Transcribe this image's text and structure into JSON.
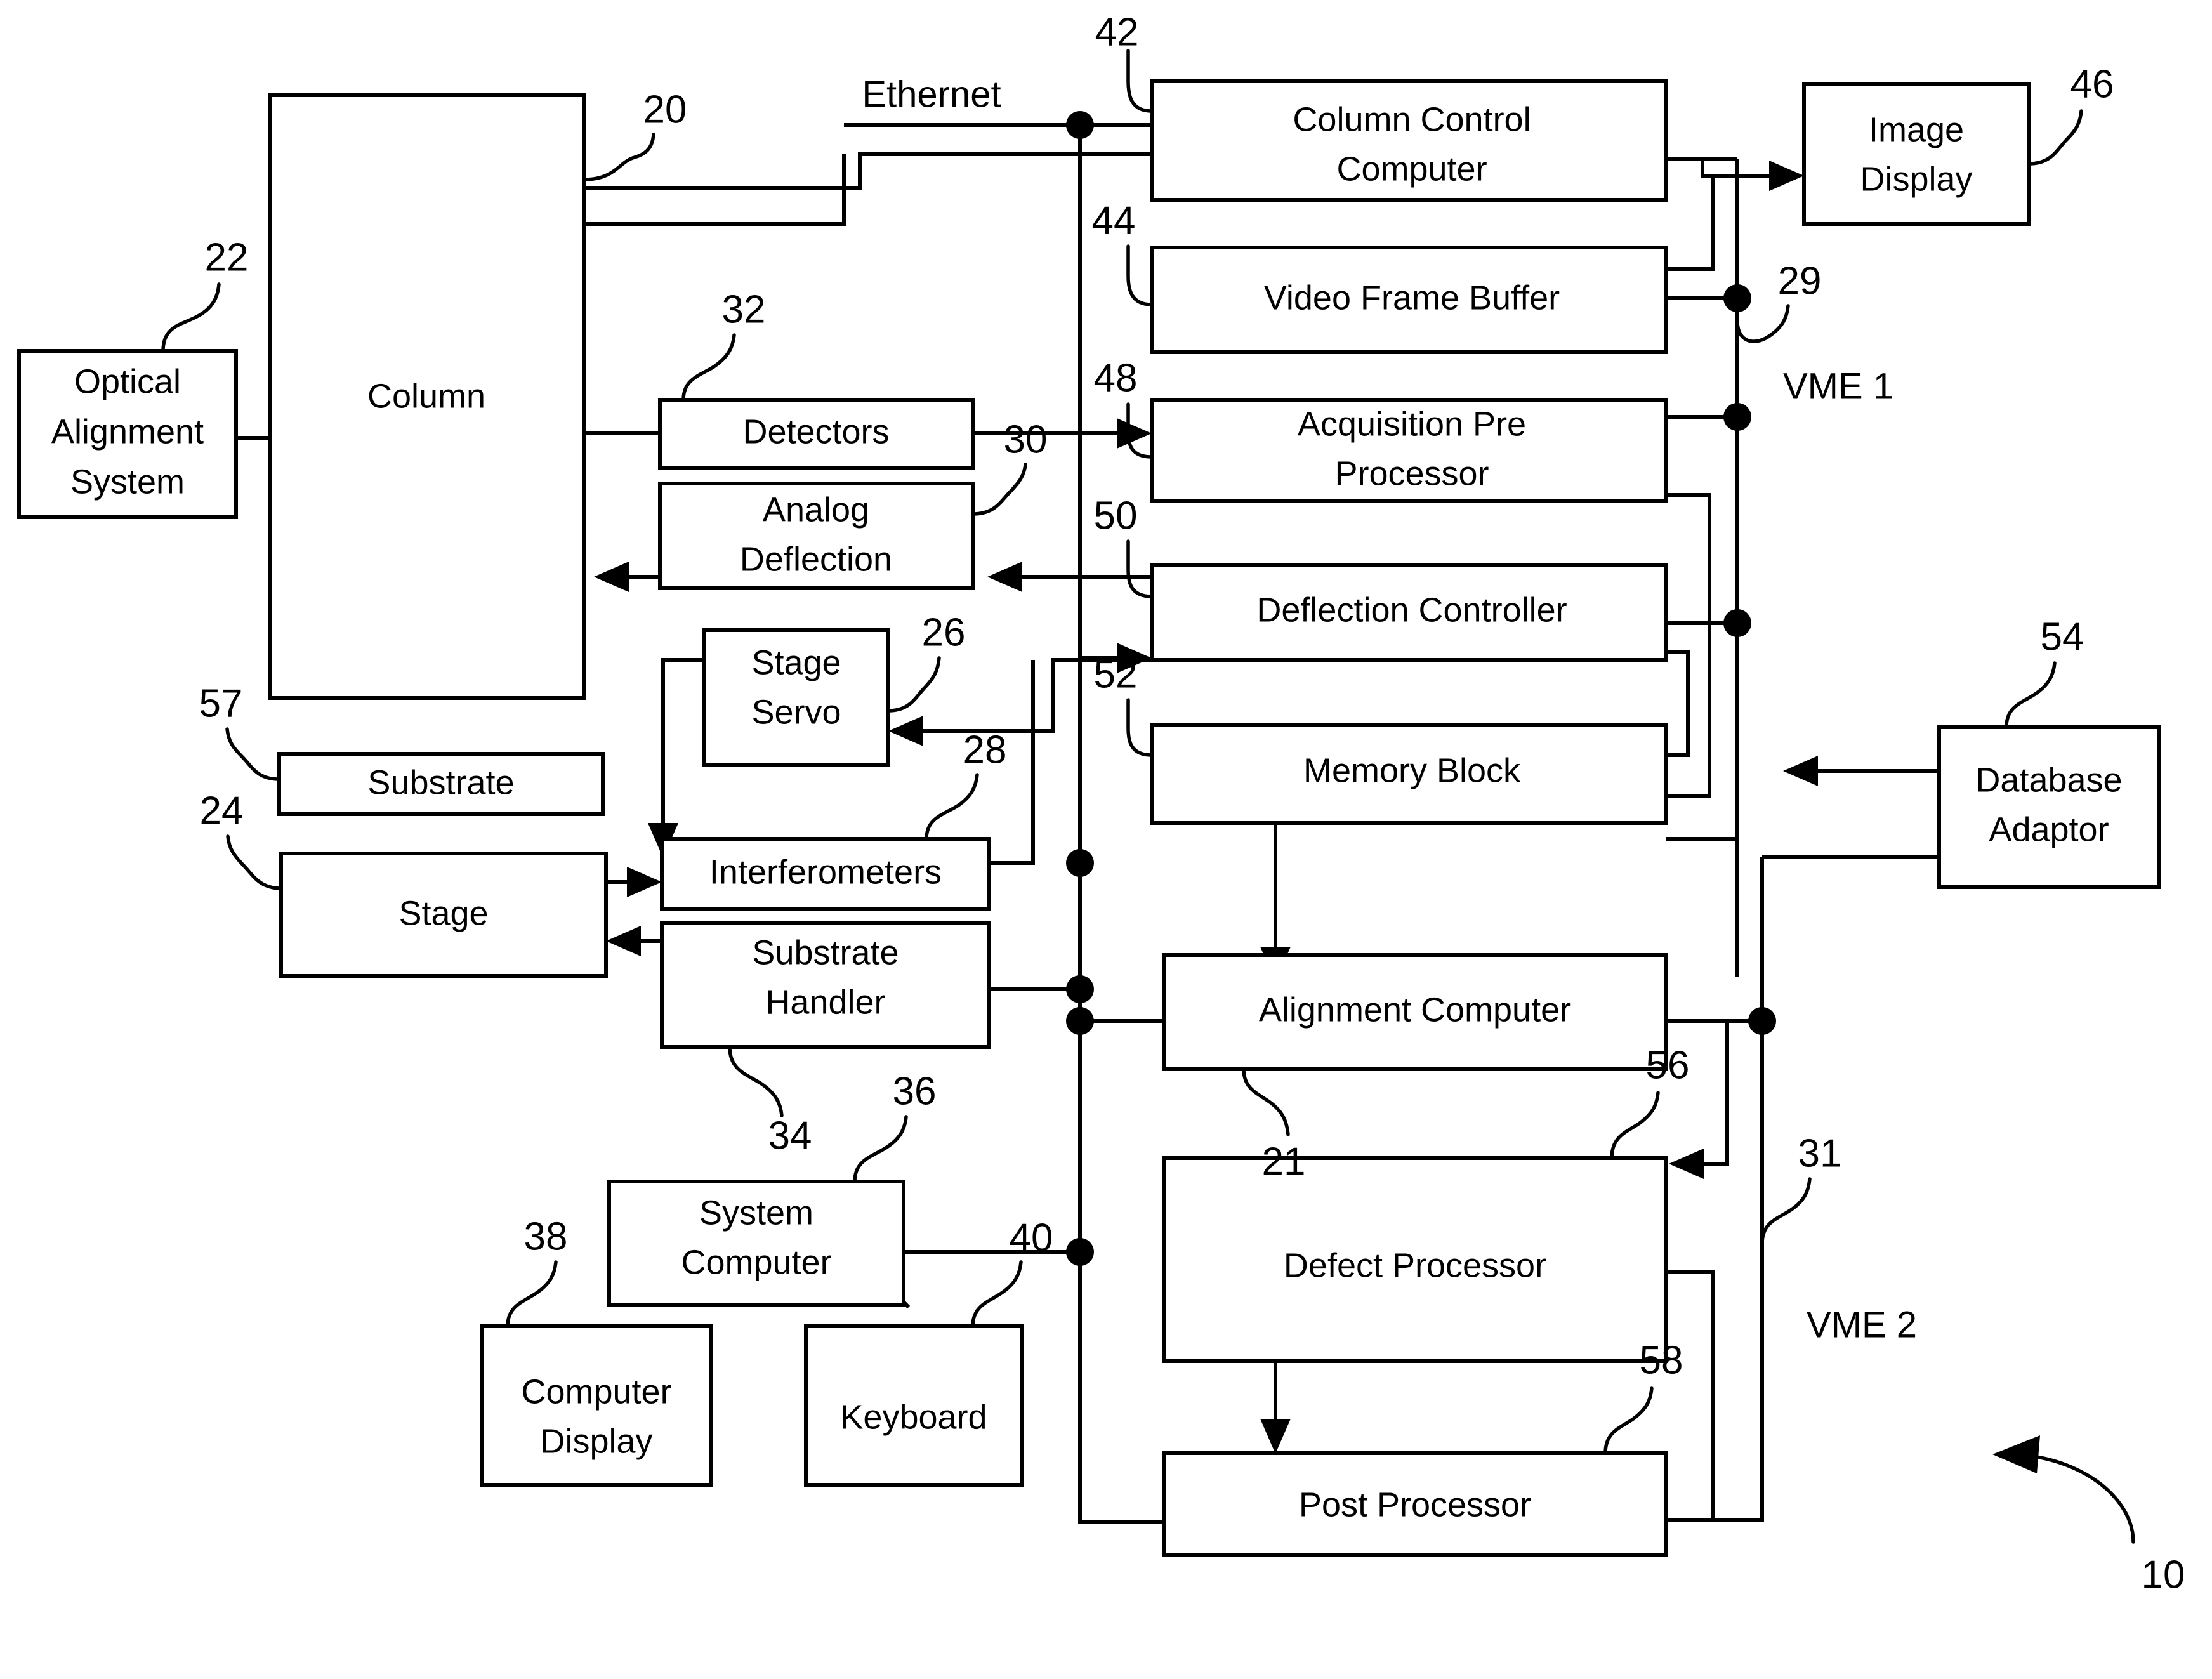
{
  "figure": {
    "kind": "patent-block-diagram",
    "overall_reference": "10",
    "network_label": "Ethernet",
    "bus_labels": [
      {
        "id": "vme1",
        "text": "VME 1",
        "reference": "29"
      },
      {
        "id": "vme2",
        "text": "VME 2",
        "reference": "31"
      }
    ]
  },
  "blocks": [
    {
      "id": "column",
      "label": "Column",
      "reference": "20"
    },
    {
      "id": "optical_alignment",
      "label": "Optical Alignment System",
      "reference": "22"
    },
    {
      "id": "detectors",
      "label": "Detectors",
      "reference": "32"
    },
    {
      "id": "analog_deflection",
      "label": "Analog Deflection",
      "reference": "30"
    },
    {
      "id": "stage_servo",
      "label": "Stage Servo",
      "reference": "26"
    },
    {
      "id": "substrate",
      "label": "Substrate",
      "reference": "57"
    },
    {
      "id": "stage",
      "label": "Stage",
      "reference": "24"
    },
    {
      "id": "interferometers",
      "label": "Interferometers",
      "reference": "28"
    },
    {
      "id": "substrate_handler",
      "label": "Substrate Handler",
      "reference": "34"
    },
    {
      "id": "system_computer",
      "label": "System Computer",
      "reference": "36"
    },
    {
      "id": "computer_display",
      "label": "Computer Display",
      "reference": "38"
    },
    {
      "id": "keyboard",
      "label": "Keyboard",
      "reference": "40"
    },
    {
      "id": "column_control",
      "label": "Column Control Computer",
      "reference": "42"
    },
    {
      "id": "video_frame_buffer",
      "label": "Video Frame Buffer",
      "reference": "44"
    },
    {
      "id": "acquisition_pre",
      "label": "Acquisition Pre Processor",
      "reference": "48"
    },
    {
      "id": "deflection_ctrl",
      "label": "Deflection Controller",
      "reference": "50"
    },
    {
      "id": "memory_block",
      "label": "Memory Block",
      "reference": "52"
    },
    {
      "id": "alignment_computer",
      "label": "Alignment Computer",
      "reference": "21"
    },
    {
      "id": "defect_processor",
      "label": "Defect Processor",
      "reference": "56"
    },
    {
      "id": "post_processor",
      "label": "Post Processor",
      "reference": "58"
    },
    {
      "id": "image_display",
      "label": "Image Display",
      "reference": "46"
    },
    {
      "id": "database_adaptor",
      "label": "Database Adaptor",
      "reference": "54"
    }
  ],
  "labels": {
    "column": "Column",
    "optical_alignment_l1": "Optical",
    "optical_alignment_l2": "Alignment",
    "optical_alignment_l3": "System",
    "detectors": "Detectors",
    "analog_deflection_l1": "Analog",
    "analog_deflection_l2": "Deflection",
    "stage_servo_l1": "Stage",
    "stage_servo_l2": "Servo",
    "substrate": "Substrate",
    "stage": "Stage",
    "interferometers": "Interferometers",
    "substrate_handler_l1": "Substrate",
    "substrate_handler_l2": "Handler",
    "system_computer_l1": "System",
    "system_computer_l2": "Computer",
    "computer_display_l1": "Computer",
    "computer_display_l2": "Display",
    "keyboard": "Keyboard",
    "column_control_l1": "Column Control",
    "column_control_l2": "Computer",
    "video_frame_buffer": "Video Frame Buffer",
    "acquisition_pre_l1": "Acquisition Pre",
    "acquisition_pre_l2": "Processor",
    "deflection_ctrl": "Deflection Controller",
    "memory_block": "Memory Block",
    "alignment_computer": "Alignment Computer",
    "defect_processor": "Defect Processor",
    "post_processor": "Post Processor",
    "image_display_l1": "Image",
    "image_display_l2": "Display",
    "database_adaptor_l1": "Database",
    "database_adaptor_l2": "Adaptor",
    "ethernet": "Ethernet",
    "vme1": "VME 1",
    "vme2": "VME 2"
  },
  "references": {
    "r10": "10",
    "r20": "20",
    "r21": "21",
    "r22": "22",
    "r24": "24",
    "r26": "26",
    "r28": "28",
    "r29": "29",
    "r30": "30",
    "r31": "31",
    "r32": "32",
    "r34": "34",
    "r36": "36",
    "r38": "38",
    "r40": "40",
    "r42": "42",
    "r44": "44",
    "r46": "46",
    "r48": "48",
    "r50": "50",
    "r52": "52",
    "r54": "54",
    "r56": "56",
    "r57": "57",
    "r58": "58"
  },
  "colors": {
    "ink": "#000000",
    "paper": "#ffffff"
  }
}
